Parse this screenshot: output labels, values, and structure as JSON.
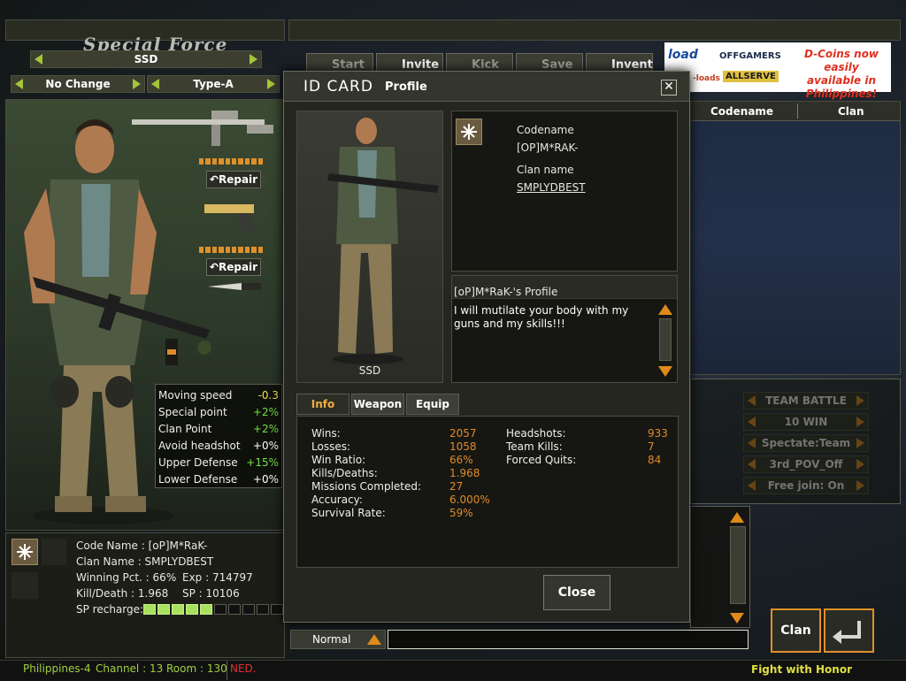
{
  "left": {
    "logo": "Special Force",
    "character_name": "SSD",
    "selector_left": "No Change",
    "selector_right": "Type-A",
    "repair_label": "Repair",
    "stats": [
      {
        "label": "Moving speed",
        "value": "-0.3",
        "color": "#f0e040"
      },
      {
        "label": "Special point",
        "value": "+2%",
        "color": "#70e040"
      },
      {
        "label": "Clan Point",
        "value": "+2%",
        "color": "#70e040"
      },
      {
        "label": "Avoid headshot",
        "value": "+0%",
        "color": "#ffffff"
      },
      {
        "label": "Upper Defense",
        "value": "+15%",
        "color": "#70e040"
      },
      {
        "label": "Lower Defense",
        "value": "+0%",
        "color": "#ffffff"
      }
    ],
    "info": {
      "code_name": "Code Name : [oP]M*RaK-",
      "clan_name": "Clan Name :  SMPLYDBEST",
      "winning": "Winning Pct. : 66%",
      "exp": "Exp : 714797",
      "kd": "Kill/Death : 1.968",
      "sp": "SP : 10106",
      "sp_recharge": "SP recharge:",
      "sp_filled": 5,
      "sp_total": 10
    }
  },
  "toolbar": {
    "start": "Start",
    "invite": "Invite",
    "kick": "Kick",
    "save": "Save",
    "invent": "Invent"
  },
  "ad": {
    "logo1": "load",
    "logo2": "OFFGAMERS",
    "logo3": "ALLSERVE",
    "promo": "D-Coins now easily available in Philippines!",
    "side": "-loads"
  },
  "list": {
    "col_codename": "Codename",
    "col_clan": "Clan"
  },
  "room_options": [
    "TEAM BATTLE",
    "10 WIN",
    "Spectate:Team",
    "3rd_POV_Off",
    "Free join: On"
  ],
  "bottom": {
    "server": "Philippines-4",
    "channel": "Channel : 13",
    "room": "Room : 130",
    "ticker": "NED.",
    "motto": "Fight with Honor",
    "chat_mode": "Normal",
    "clan_btn": "Clan"
  },
  "modal": {
    "title": "ID CARD",
    "subtitle": "Profile",
    "codename_label": "Codename",
    "codename": "[OP]M*RAK-",
    "clan_label": "Clan name",
    "clan": "SMPLYDBEST",
    "portrait_label": "SSD",
    "profile_title": "[oP]M*RaK-'s Profile",
    "profile_text": "I will mutilate your body with my guns and my skills!!!",
    "tabs": [
      "Info",
      "Weapon",
      "Equip"
    ],
    "stats_left": [
      {
        "label": "Wins:",
        "value": "2057"
      },
      {
        "label": "Losses:",
        "value": "1058"
      },
      {
        "label": "Win Ratio:",
        "value": "66%"
      },
      {
        "label": "Kills/Deaths:",
        "value": "1.968"
      },
      {
        "label": "Missions Completed:",
        "value": "27"
      },
      {
        "label": "Accuracy:",
        "value": "6.000%"
      },
      {
        "label": "Survival Rate:",
        "value": "59%"
      }
    ],
    "stats_right": [
      {
        "label": "Headshots:",
        "value": "933"
      },
      {
        "label": "Team Kills:",
        "value": "7"
      },
      {
        "label": "Forced Quits:",
        "value": "84"
      }
    ],
    "close": "Close"
  }
}
